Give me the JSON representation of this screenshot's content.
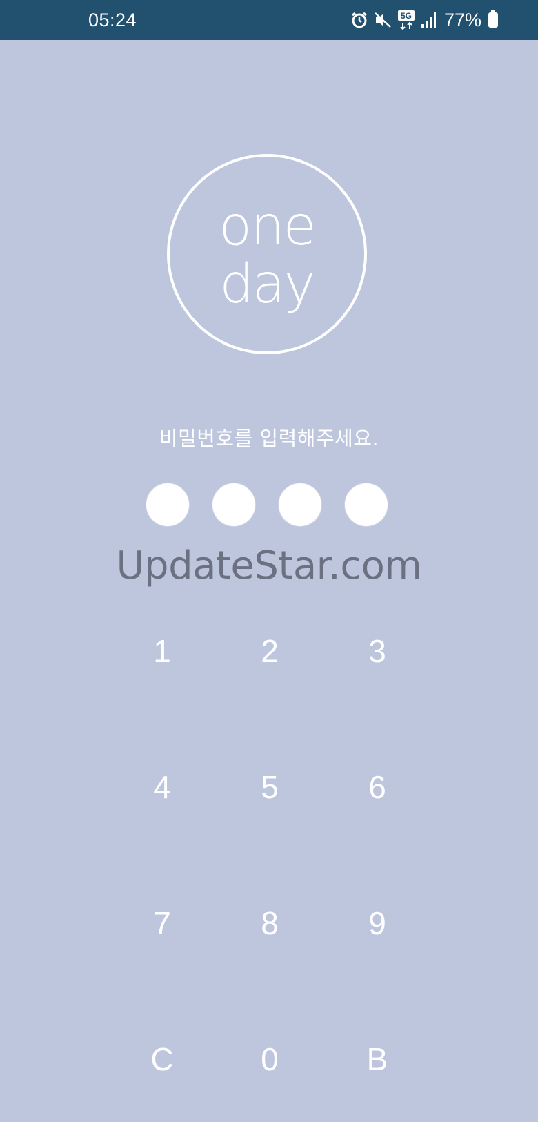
{
  "status_bar": {
    "time": "05:24",
    "icons": [
      "alarm-icon",
      "mute-icon",
      "5g-icon",
      "signal-icon"
    ],
    "icon_glyphs": [
      "⏰",
      "🔇",
      "5G",
      "▂▄▆"
    ],
    "battery_percent": "77%",
    "battery_level": 0.77
  },
  "logo": {
    "line1": "one",
    "line2": "day"
  },
  "prompt": "비밀번호를 입력해주세요.",
  "pin": {
    "length": 4,
    "filled": 0
  },
  "watermark": "UpdateStar.com",
  "keypad": {
    "keys": [
      "1",
      "2",
      "3",
      "4",
      "5",
      "6",
      "7",
      "8",
      "9",
      "C",
      "0",
      "B"
    ]
  },
  "colors": {
    "background": "#bec6de",
    "status_bar": "#21516f",
    "foreground": "#ffffff",
    "watermark": "#6b7181"
  }
}
